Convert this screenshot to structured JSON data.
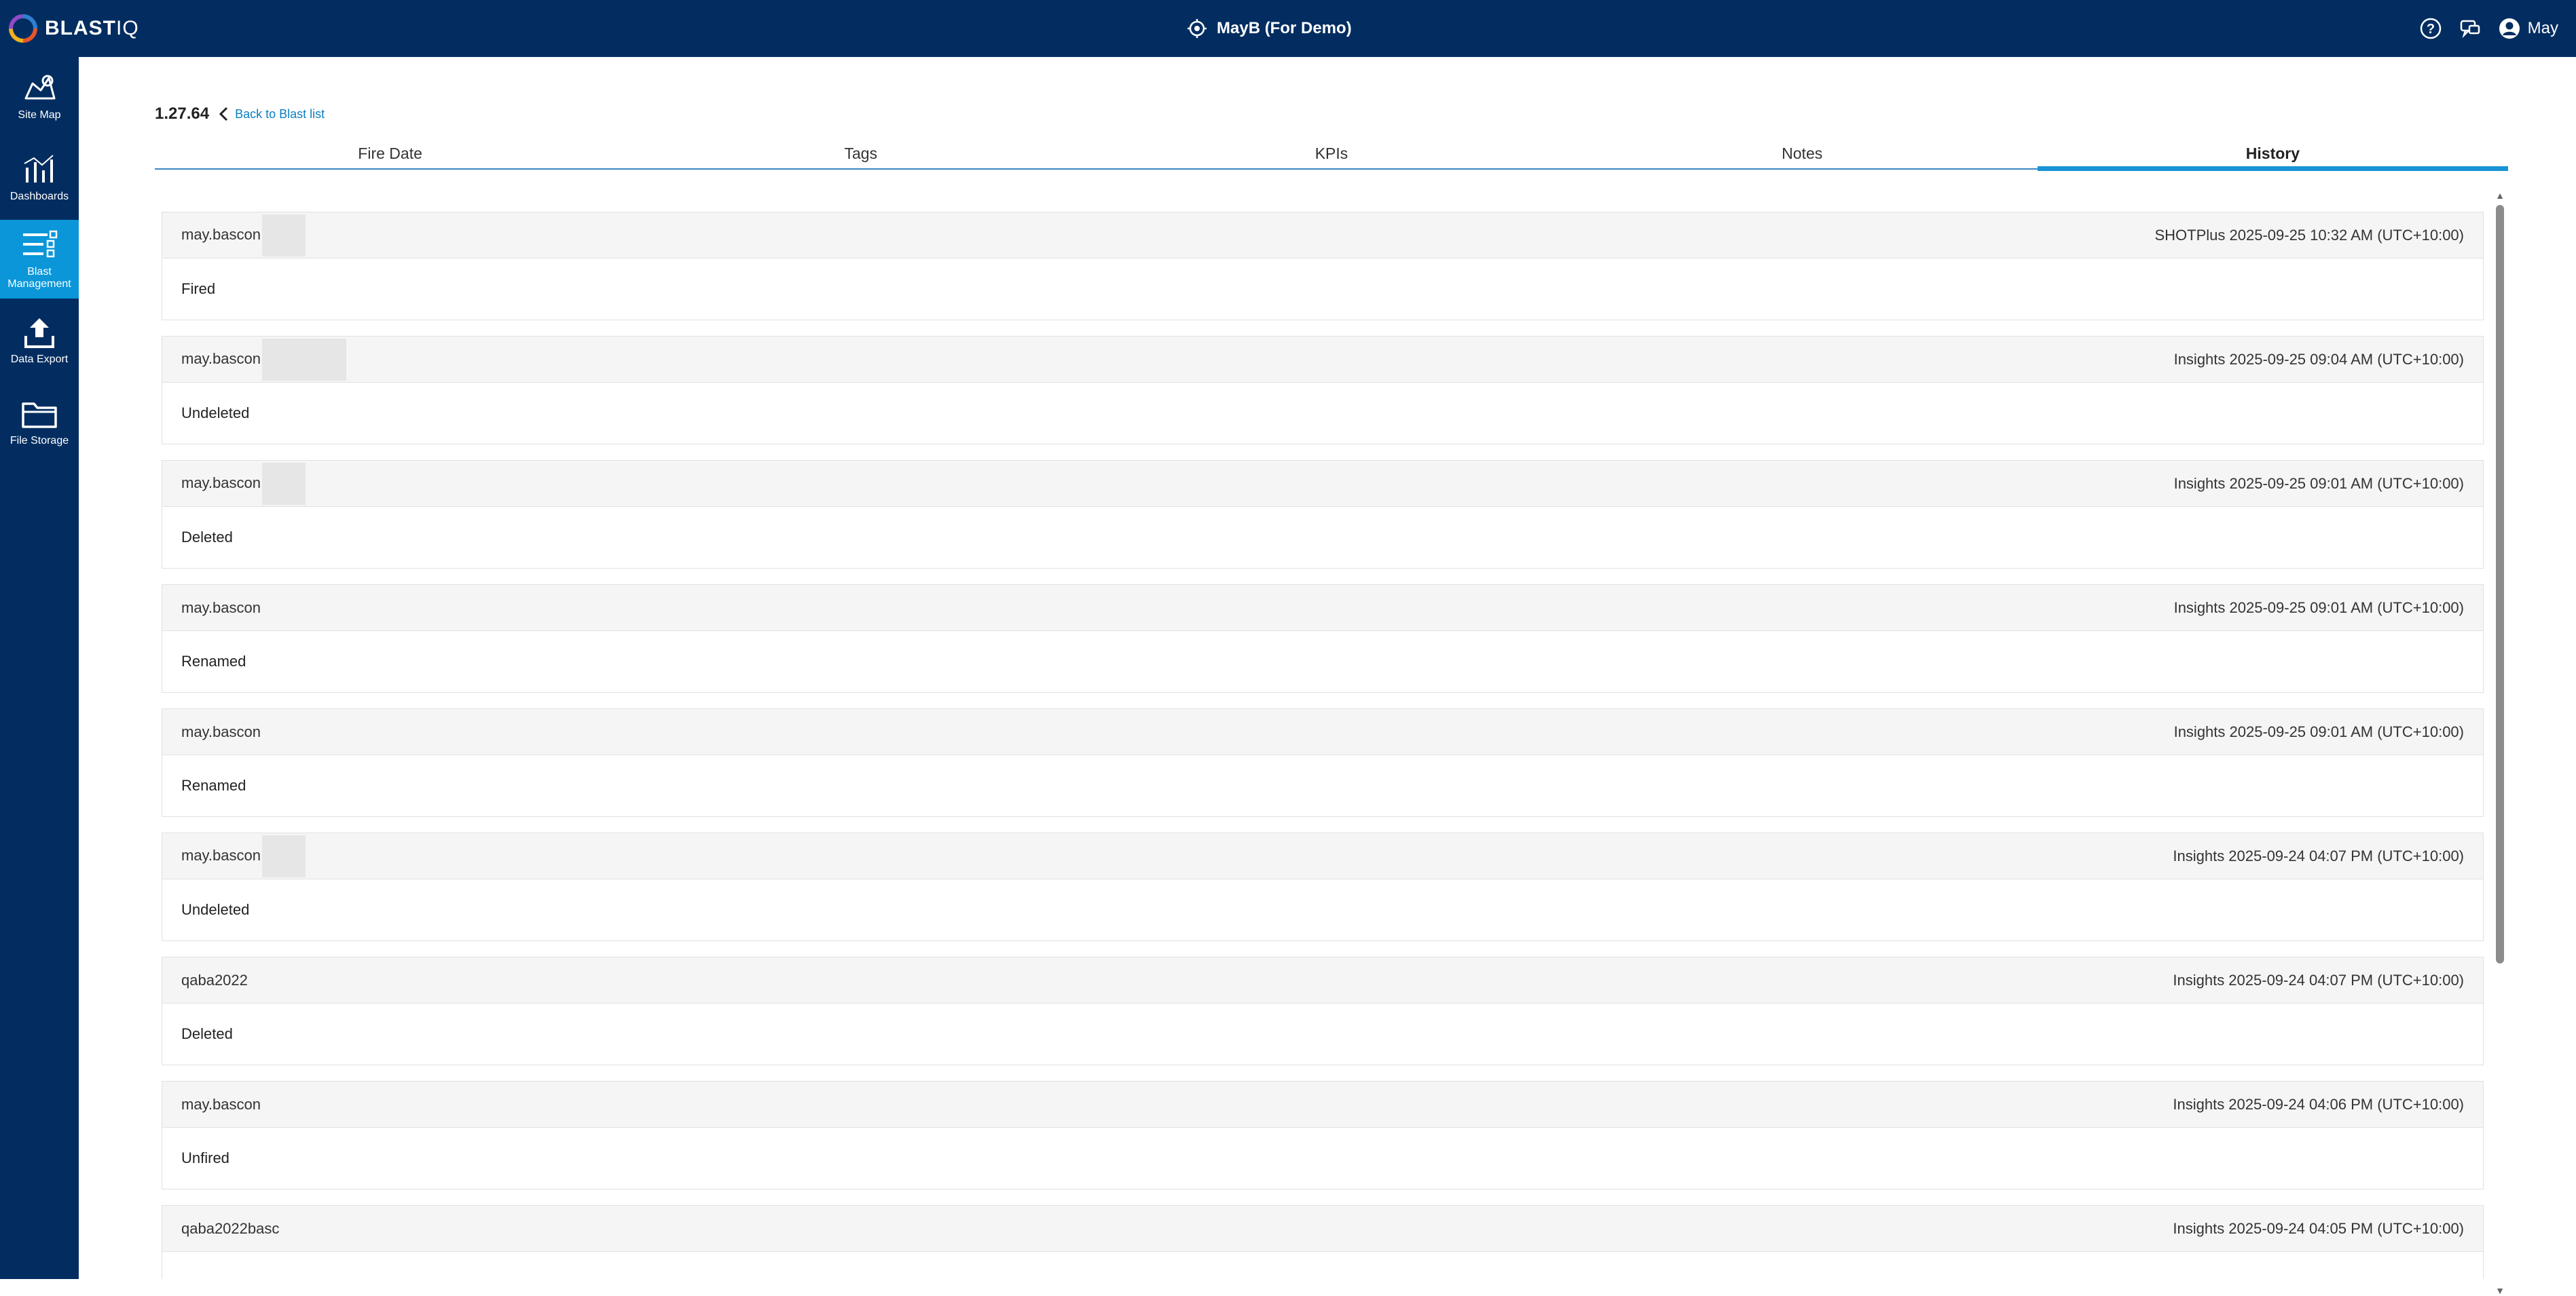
{
  "header": {
    "logo_main": "BLAST",
    "logo_suffix": "IQ",
    "site_name": "MayB (For Demo)",
    "user_name": "May"
  },
  "sidebar": {
    "items": [
      {
        "label_line1": "Site Map",
        "label_line2": ""
      },
      {
        "label_line1": "Dashboards",
        "label_line2": ""
      },
      {
        "label_line1": "Blast",
        "label_line2": "Management"
      },
      {
        "label_line1": "Data Export",
        "label_line2": ""
      },
      {
        "label_line1": "File Storage",
        "label_line2": ""
      }
    ]
  },
  "page": {
    "blast_id": "1.27.64",
    "back_label": "Back to Blast list"
  },
  "tabs": [
    {
      "label": "Fire Date"
    },
    {
      "label": "Tags"
    },
    {
      "label": "KPIs"
    },
    {
      "label": "Notes"
    },
    {
      "label": "History",
      "active": true
    }
  ],
  "history": [
    {
      "user": "may.bascon",
      "source_time": "SHOTPlus 2025-09-25 10:32 AM (UTC+10:00)",
      "action": "Fired"
    },
    {
      "user": "may.bascon",
      "source_time": "Insights 2025-09-25 09:04 AM (UTC+10:00)",
      "action": "Undeleted"
    },
    {
      "user": "may.bascon",
      "source_time": "Insights 2025-09-25 09:01 AM (UTC+10:00)",
      "action": "Deleted"
    },
    {
      "user": "may.bascon",
      "source_time": "Insights 2025-09-25 09:01 AM (UTC+10:00)",
      "action": "Renamed"
    },
    {
      "user": "may.bascon",
      "source_time": "Insights 2025-09-25 09:01 AM (UTC+10:00)",
      "action": "Renamed"
    },
    {
      "user": "may.bascon",
      "source_time": "Insights 2025-09-24 04:07 PM (UTC+10:00)",
      "action": "Undeleted"
    },
    {
      "user": "qaba2022",
      "source_time": "Insights 2025-09-24 04:07 PM (UTC+10:00)",
      "action": "Deleted"
    },
    {
      "user": "may.bascon",
      "source_time": "Insights 2025-09-24 04:06 PM (UTC+10:00)",
      "action": "Unfired"
    },
    {
      "user": "qaba2022basc",
      "source_time": "Insights 2025-09-24 04:05 PM (UTC+10:00)",
      "action": ""
    }
  ],
  "colors": {
    "nav_bg": "#032d60",
    "nav_active": "#0a96d8",
    "tab_indicator": "#1993d6",
    "link": "#0a7ec2"
  }
}
